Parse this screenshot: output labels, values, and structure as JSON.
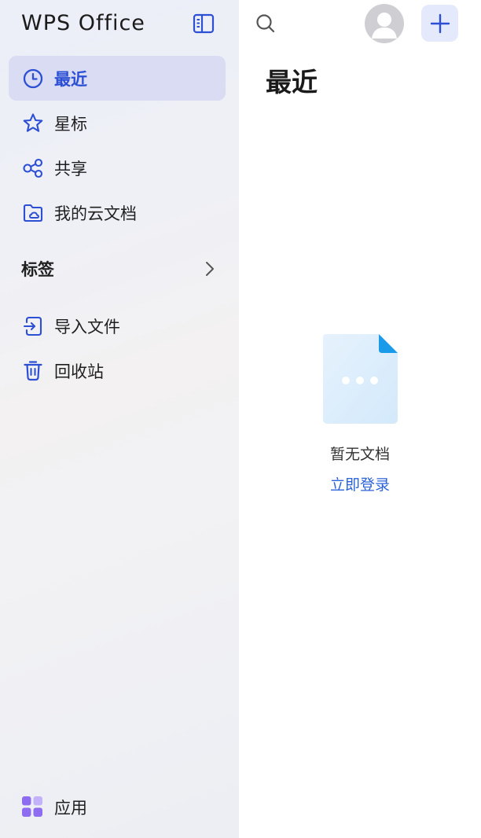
{
  "app": {
    "logo_text": "WPS Office"
  },
  "nav": {
    "items": [
      {
        "label": "最近",
        "icon": "clock-icon",
        "active": true
      },
      {
        "label": "星标",
        "icon": "star-icon"
      },
      {
        "label": "共享",
        "icon": "share-icon"
      },
      {
        "label": "我的云文档",
        "icon": "cloud-folder-icon"
      }
    ]
  },
  "tags": {
    "label": "标签"
  },
  "nav2": {
    "items": [
      {
        "label": "导入文件",
        "icon": "import-icon"
      },
      {
        "label": "回收站",
        "icon": "trash-icon"
      }
    ]
  },
  "apps": {
    "label": "应用",
    "icon": "apps-grid-icon"
  },
  "header": {
    "search_icon": "search-icon",
    "add_icon": "plus-icon",
    "avatar_icon": "user-avatar-icon"
  },
  "main": {
    "title": "最近",
    "empty_text": "暂无文档",
    "login_text": "立即登录"
  },
  "colors": {
    "accent": "#2c4fd4",
    "link": "#2b63d9",
    "active_bg": "#d9dcf2",
    "add_bg": "#e4e9fb"
  }
}
